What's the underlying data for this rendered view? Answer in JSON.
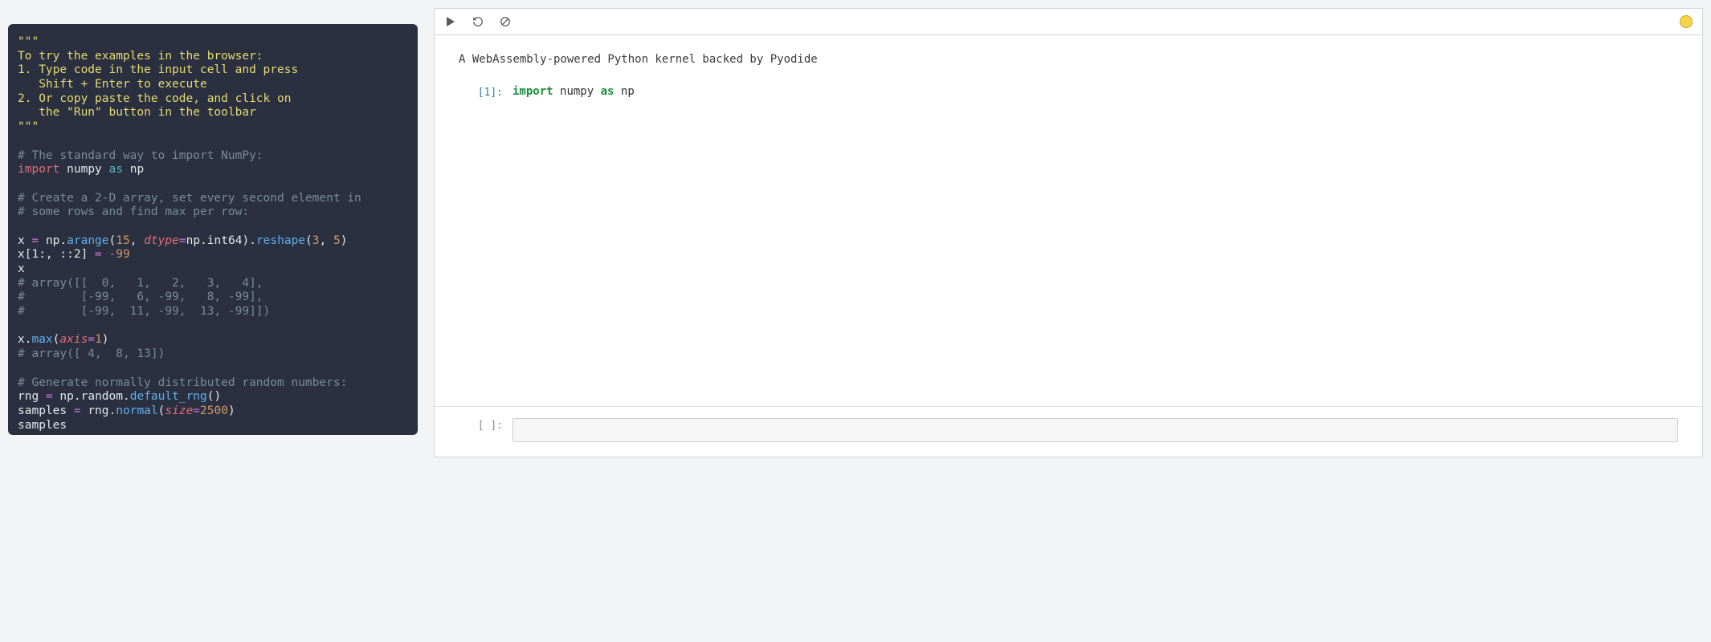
{
  "left_code": {
    "docstring_quote_open": "\"\"\"",
    "doc_l1": "To try the examples in the browser:",
    "doc_l2": "1. Type code in the input cell and press",
    "doc_l3": "   Shift + Enter to execute",
    "doc_l4": "2. Or copy paste the code, and click on",
    "doc_l5": "   the \"Run\" button in the toolbar",
    "docstring_quote_close": "\"\"\"",
    "comment_import": "# The standard way to import NumPy:",
    "kw_import": "import",
    "mod_numpy": "numpy",
    "kw_as": "as",
    "alias_np": "np",
    "comment_2d_1": "# Create a 2-D array, set every second element in",
    "comment_2d_2": "# some rows and find max per row:",
    "x": "x",
    "eq": "=",
    "np": "np",
    "dot": ".",
    "arange": "arange",
    "n15": "15",
    "dtype": "dtype",
    "int64": "int64",
    "reshape": "reshape",
    "n3": "3",
    "n5": "5",
    "slice": "x[1:, ::2]",
    "neg99": "-99",
    "arr_c1": "# array([[  0,   1,   2,   3,   4],",
    "arr_c2": "#        [-99,   6, -99,   8, -99],",
    "arr_c3": "#        [-99,  11, -99,  13, -99]])",
    "max": "max",
    "axis": "axis",
    "n1": "1",
    "maxres": "# array([ 4,  8, 13])",
    "comment_rng": "# Generate normally distributed random numbers:",
    "rng": "rng",
    "random": "random",
    "default_rng": "default_rng",
    "samples": "samples",
    "normal": "normal",
    "size": "size",
    "n2500": "2500"
  },
  "notebook": {
    "toolbar": {
      "run": "run",
      "restart": "restart",
      "interrupt": "interrupt"
    },
    "markdown": "A WebAssembly-powered Python kernel backed by Pyodide",
    "cell1": {
      "prompt": "[1]:",
      "kw_import": "import",
      "mod": "numpy",
      "kw_as": "as",
      "alias": "np"
    },
    "footer_prompt": "[ ]:",
    "footer_value": ""
  }
}
